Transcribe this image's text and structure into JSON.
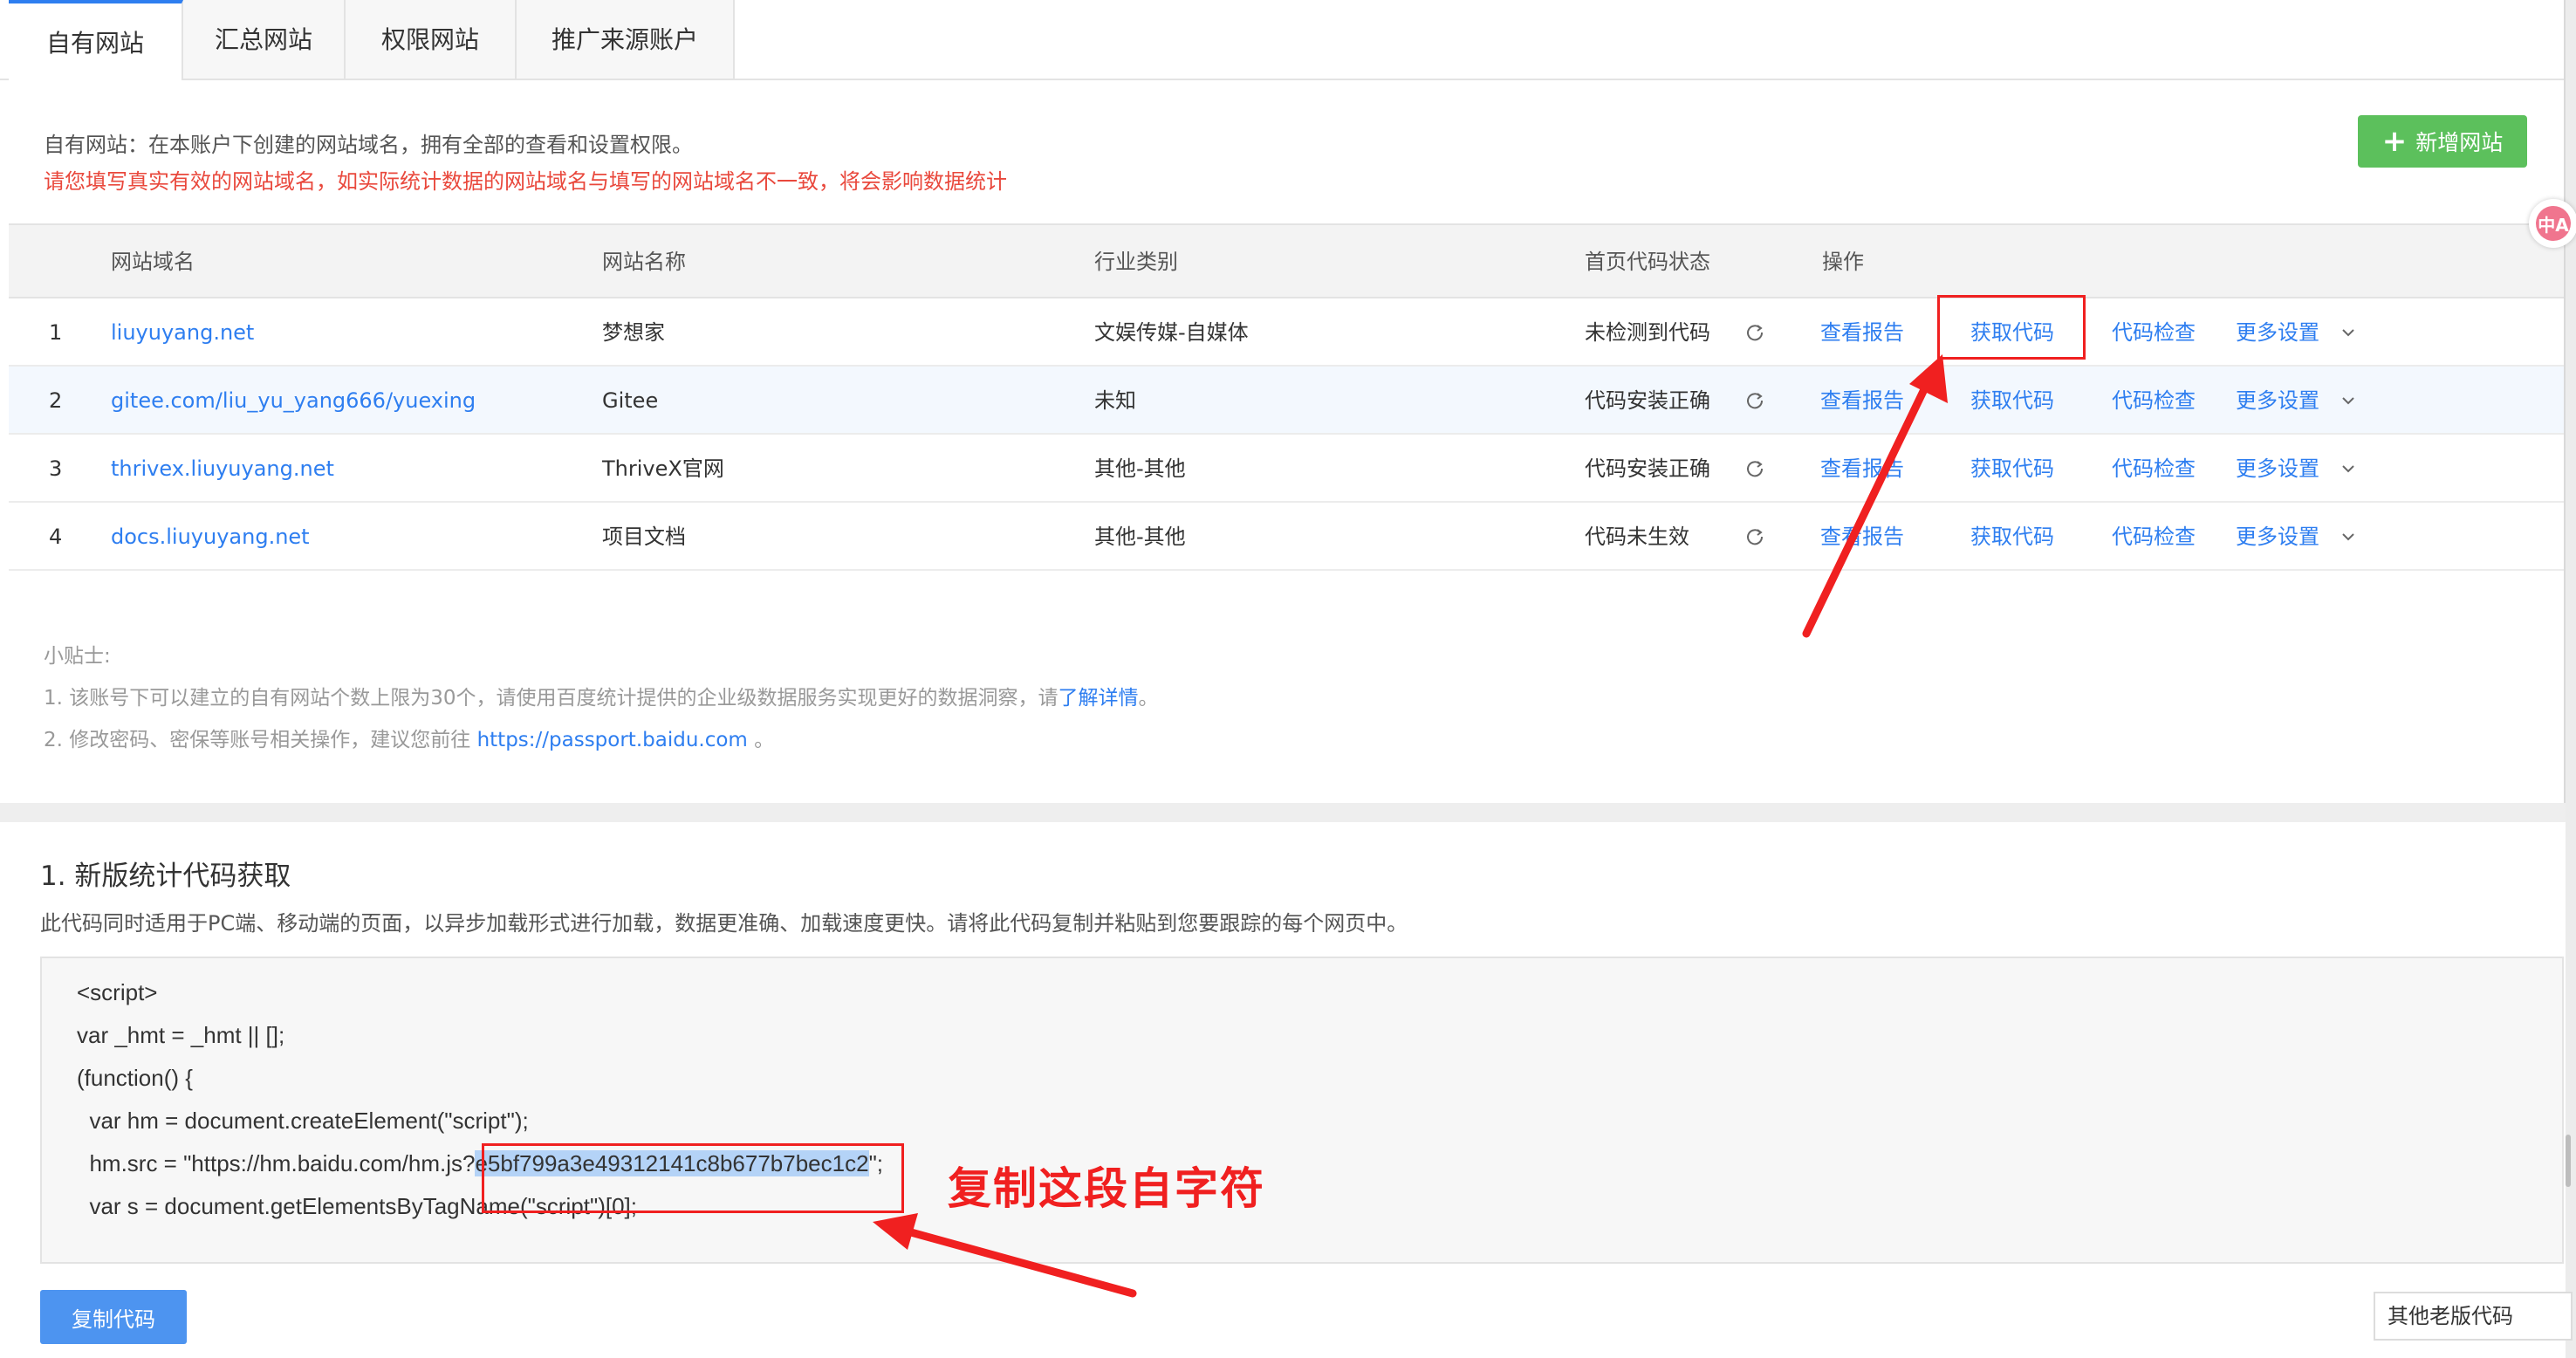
{
  "tabs": [
    "自有网站",
    "汇总网站",
    "权限网站",
    "推广来源账户"
  ],
  "active_tab": "自有网站",
  "intro": {
    "desc": "自有网站：在本账户下创建的网站域名，拥有全部的查看和设置权限。",
    "warning": "请您填写真实有效的网站域名，如实际统计数据的网站域名与填写的网站域名不一致，将会影响数据统计"
  },
  "add_site_label": "新增网站",
  "translate_badge": "中A",
  "table": {
    "headers": {
      "domain": "网站域名",
      "name": "网站名称",
      "industry": "行业类别",
      "status": "首页代码状态",
      "ops": "操作"
    },
    "action_labels": {
      "report": "查看报告",
      "get_code": "获取代码",
      "check_code": "代码检查",
      "more": "更多设置"
    },
    "rows": [
      {
        "index": "1",
        "domain": "liuyuyang.net",
        "name": "梦想家",
        "industry": "文娱传媒-自媒体",
        "status": "未检测到代码"
      },
      {
        "index": "2",
        "domain": "gitee.com/liu_yu_yang666/yuexing",
        "name": "Gitee",
        "industry": "未知",
        "status": "代码安装正确"
      },
      {
        "index": "3",
        "domain": "thrivex.liuyuyang.net",
        "name": "ThriveX官网",
        "industry": "其他-其他",
        "status": "代码安装正确"
      },
      {
        "index": "4",
        "domain": "docs.liuyuyang.net",
        "name": "项目文档",
        "industry": "其他-其他",
        "status": "代码未生效"
      }
    ]
  },
  "tips": {
    "title": "小贴士:",
    "tip1_prefix": "1. 该账号下可以建立的自有网站个数上限为30个，请使用百度统计提供的企业级数据服务实现更好的数据洞察，请",
    "tip1_link": "了解详情",
    "tip1_suffix": "。",
    "tip2_prefix": "2. 修改密码、密保等账号相关操作，建议您前往 ",
    "tip2_link": "https://passport.baidu.com",
    "tip2_suffix": " 。"
  },
  "code_section": {
    "title": "1. 新版统计代码获取",
    "desc": "此代码同时适用于PC端、移动端的页面，以异步加载形式进行加载，数据更准确、加载速度更快。请将此代码复制并粘贴到您要跟踪的每个网页中。",
    "lines": [
      "<script>",
      "var _hmt = _hmt || [];",
      "(function() {",
      "  var hm = document.createElement(\"script\");"
    ],
    "src_prefix": "  hm.src = \"https://hm.baidu.com/hm.js?",
    "src_key": "e5bf799a3e49312141c8b677b7bec1c2",
    "src_suffix": "\";",
    "last_line": "  var s = document.getElementsByTagName(\"script\")[0];",
    "annotation": "复制这段自字符",
    "copy_button": "复制代码",
    "old_version": "其他老版代码"
  },
  "colors": {
    "link": "#2e7ef0",
    "warning": "#e9483c",
    "add_button": "#5cc05c",
    "annotation": "#f02020"
  }
}
